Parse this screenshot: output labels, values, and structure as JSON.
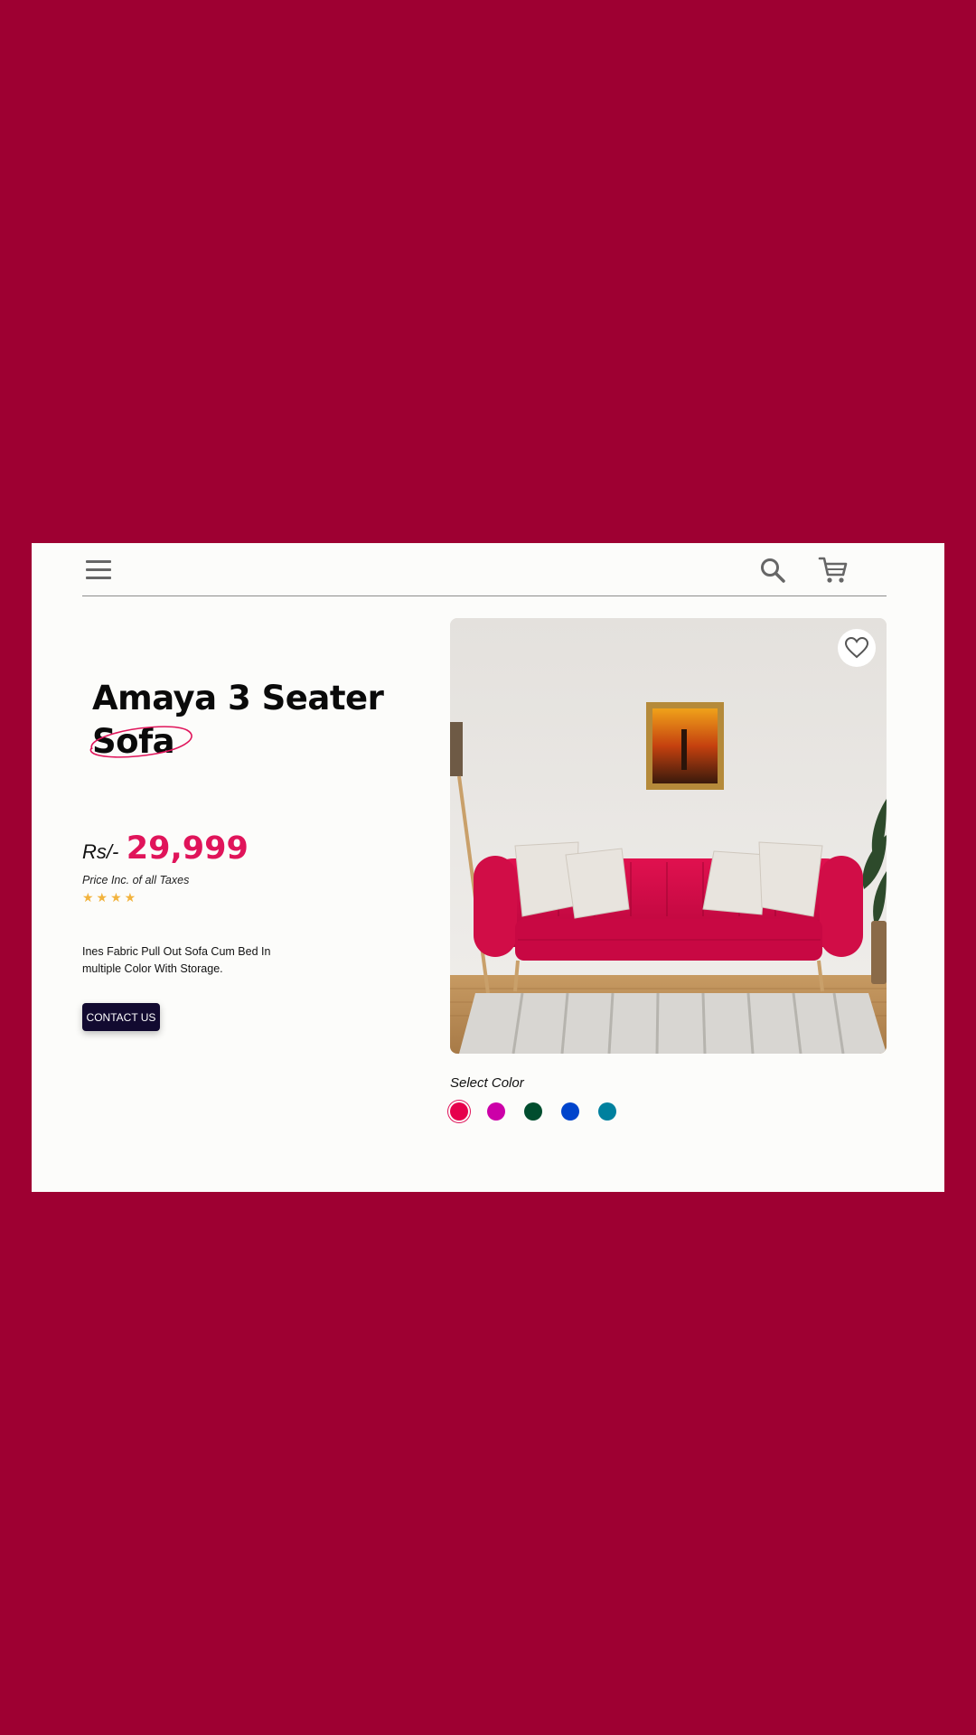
{
  "product": {
    "title_line1": "Amaya 3 Seater",
    "title_line2": "Sofa",
    "price_prefix": "Rs/-",
    "price_value": "29,999",
    "price_note": "Price Inc. of all Taxes",
    "rating_stars": "★★★★",
    "rating": 4,
    "description": "Ines Fabric Pull Out Sofa Cum Bed In multiple Color With Storage.",
    "contact_label": "CONTACT US"
  },
  "header": {
    "icons": [
      "menu-icon",
      "search-icon",
      "cart-icon"
    ]
  },
  "image": {
    "favorite_icon": "heart-icon"
  },
  "color_picker": {
    "label": "Select Color",
    "selected": "#e6004c",
    "options": [
      "#e6004c",
      "#cc00a8",
      "#004d2e",
      "#0044cc",
      "#00809e"
    ]
  },
  "theme": {
    "background": "#9e0032",
    "accent": "#e0145a",
    "button_bg": "#120a30",
    "star_color": "#f2b33d"
  }
}
